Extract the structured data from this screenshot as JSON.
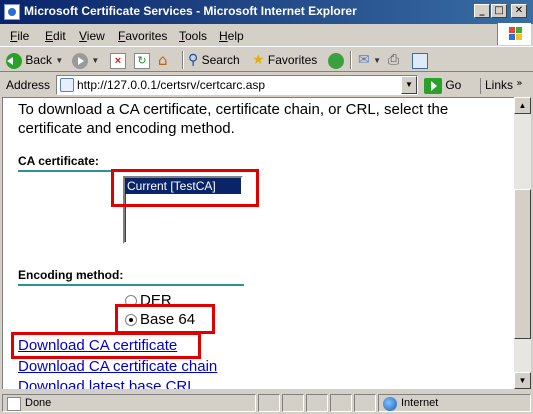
{
  "window": {
    "title": "Microsoft Certificate Services - Microsoft Internet Explorer",
    "minimize_glyph": "_",
    "maximize_glyph": "□",
    "close_glyph": "✕"
  },
  "menu": {
    "items": [
      {
        "label": "File"
      },
      {
        "label": "Edit"
      },
      {
        "label": "View"
      },
      {
        "label": "Favorites"
      },
      {
        "label": "Tools"
      },
      {
        "label": "Help"
      }
    ]
  },
  "toolbar": {
    "back_label": "Back",
    "search_label": "Search",
    "favorites_label": "Favorites"
  },
  "address": {
    "label": "Address",
    "url": "http://127.0.0.1/certsrv/certcarc.asp",
    "go_label": "Go",
    "links_label": "Links"
  },
  "page": {
    "intro": "To download a CA certificate, certificate chain, or CRL, select the certificate and encoding method.",
    "ca_certificate_heading": "CA certificate:",
    "ca_certificates": [
      "Current [TestCA]"
    ],
    "encoding_heading": "Encoding method:",
    "encoding_options": [
      {
        "label": "DER",
        "selected": false
      },
      {
        "label": "Base 64",
        "selected": true
      }
    ],
    "links": [
      "Download CA certificate",
      "Download CA certificate chain",
      "Download latest base CRL"
    ]
  },
  "status": {
    "text": "Done",
    "zone": "Internet"
  },
  "colors": {
    "highlight_box": "#e00000",
    "link": "#0000cc",
    "selection": "#0a246a",
    "section_rule": "#2f8f9a"
  }
}
